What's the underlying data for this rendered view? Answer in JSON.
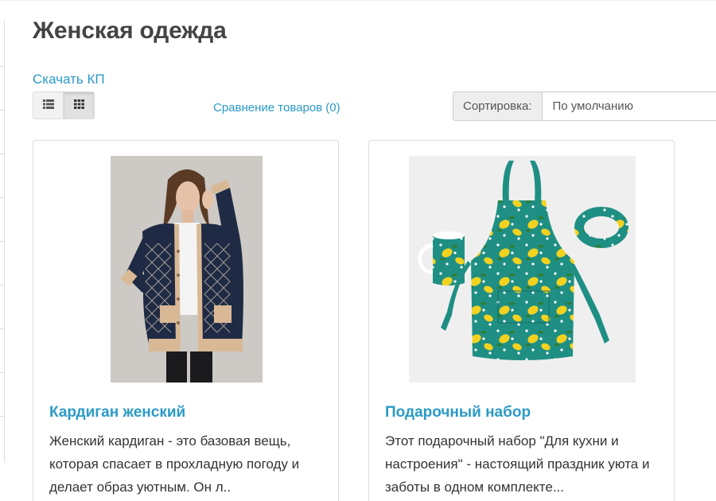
{
  "page": {
    "title": "Женская одежда",
    "download_link": "Скачать КП",
    "compare_link": "Сравнение товаров (0)"
  },
  "view_toggle": {
    "list_icon": "list-icon",
    "grid_icon": "grid-icon",
    "active": "grid"
  },
  "sort": {
    "label": "Сортировка:",
    "selected": "По умолчанию"
  },
  "products": [
    {
      "title": "Кардиган женский",
      "description": "Женский кардиган - это базовая вещь, которая спасает в прохладную погоду и делает образ уютным. Он л.."
    },
    {
      "title": "Подарочный набор",
      "description": "Этот подарочный набор \"Для кухни и настроения\" - настоящий праздник уюта и заботы в одном комплекте..."
    }
  ],
  "colors": {
    "accent_link": "#2a9ac6",
    "title_text": "#444444",
    "apron_teal": "#1f8f84",
    "lemon_yellow": "#f3d21f"
  }
}
